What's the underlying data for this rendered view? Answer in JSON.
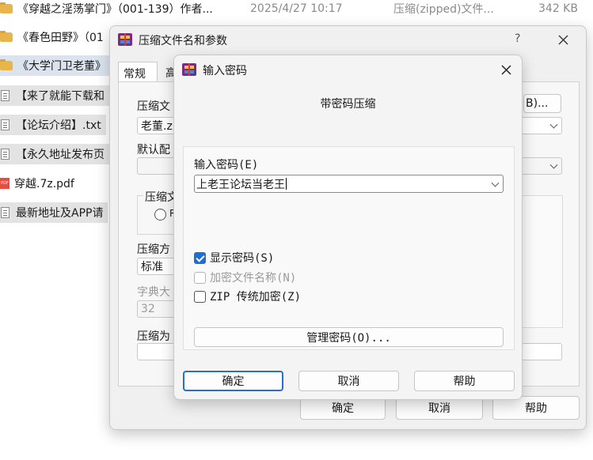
{
  "explorer": {
    "rows": [
      {
        "name": "《穿越之淫荡掌门》（001-139）作者...",
        "date": "2025/4/27 10:17",
        "type": "压缩(zipped)文件...",
        "size": "342 KB",
        "icon": "folder-zip-icon"
      },
      {
        "name": "《春色田野》（01",
        "icon": "folder-zip-icon"
      },
      {
        "name": "《大学门卫老董》",
        "icon": "folder-zip-icon"
      },
      {
        "name": "【来了就能下载和",
        "icon": "text-file-icon"
      },
      {
        "name": "【论坛介绍】.txt",
        "icon": "text-file-icon"
      },
      {
        "name": "【永久地址发布页",
        "icon": "text-file-icon"
      },
      {
        "name": "穿越.7z.pdf",
        "icon": "pdf-file-icon",
        "icon_text": "PDF"
      },
      {
        "name": "最新地址及APP请",
        "icon": "text-file-icon"
      }
    ]
  },
  "archive_dialog": {
    "title": "压缩文件名和参数",
    "help_glyph": "?",
    "tabs": [
      "常规",
      "高"
    ],
    "archive_label": "压缩文",
    "browse_label": "B)...",
    "archive_name": "老董.z",
    "profile_label": "默认配",
    "format_group": "压缩文",
    "format_radio": "R",
    "method_label": "压缩方",
    "method_value": "标准",
    "dict_label": "字典大",
    "dict_value": "32",
    "split_label": "压缩为",
    "ok": "确定",
    "cancel": "取消",
    "help": "帮助"
  },
  "password_dialog": {
    "title": "输入密码",
    "heading": "带密码压缩",
    "enter_label": "输入密码(E)",
    "password_value": "上老王论坛当老王",
    "show_password": "显示密码(S)",
    "show_password_checked": true,
    "encrypt_names": "加密文件名称(N)",
    "encrypt_names_checked": false,
    "zip_legacy": "ZIP 传统加密(Z)",
    "zip_legacy_checked": false,
    "manage": "管理密码(O)...",
    "ok": "确定",
    "cancel": "取消",
    "help": "帮助"
  },
  "colors": {
    "accent": "#1f6fd1",
    "selected_row": "#dbe3ee",
    "dialog_bg": "#f0f0f0"
  }
}
